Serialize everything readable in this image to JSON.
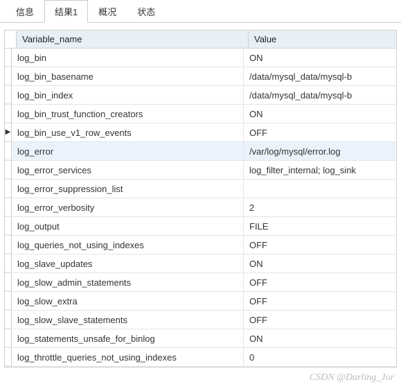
{
  "tabs": [
    {
      "label": "信息",
      "active": false
    },
    {
      "label": "结果1",
      "active": true
    },
    {
      "label": "概况",
      "active": false
    },
    {
      "label": "状态",
      "active": false
    }
  ],
  "columns": {
    "name": "Variable_name",
    "value": "Value"
  },
  "current_row_index": 4,
  "highlight_row_index": 5,
  "rows": [
    {
      "name": "log_bin",
      "value": "ON"
    },
    {
      "name": "log_bin_basename",
      "value": "/data/mysql_data/mysql-b"
    },
    {
      "name": "log_bin_index",
      "value": "/data/mysql_data/mysql-b"
    },
    {
      "name": "log_bin_trust_function_creators",
      "value": "ON"
    },
    {
      "name": "log_bin_use_v1_row_events",
      "value": "OFF"
    },
    {
      "name": "log_error",
      "value": "/var/log/mysql/error.log"
    },
    {
      "name": "log_error_services",
      "value": "log_filter_internal; log_sink"
    },
    {
      "name": "log_error_suppression_list",
      "value": ""
    },
    {
      "name": "log_error_verbosity",
      "value": "2"
    },
    {
      "name": "log_output",
      "value": "FILE"
    },
    {
      "name": "log_queries_not_using_indexes",
      "value": "OFF"
    },
    {
      "name": "log_slave_updates",
      "value": "ON"
    },
    {
      "name": "log_slow_admin_statements",
      "value": "OFF"
    },
    {
      "name": "log_slow_extra",
      "value": "OFF"
    },
    {
      "name": "log_slow_slave_statements",
      "value": "OFF"
    },
    {
      "name": "log_statements_unsafe_for_binlog",
      "value": "ON"
    },
    {
      "name": "log_throttle_queries_not_using_indexes",
      "value": "0"
    }
  ],
  "watermark": "CSDN @Darling_Jor"
}
